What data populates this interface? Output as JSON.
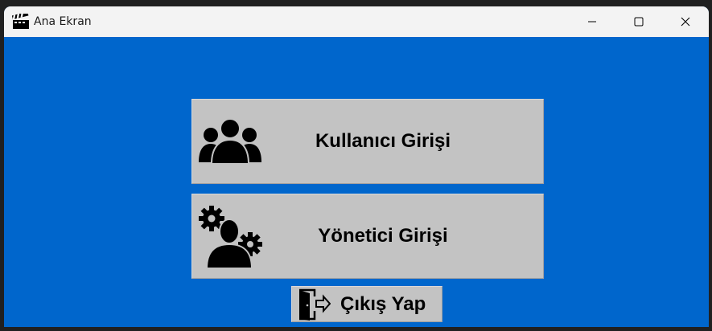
{
  "window": {
    "title": "Ana Ekran",
    "app_icon": "clapperboard-icon",
    "controls": [
      "minimize-icon",
      "maximize-icon",
      "close-icon"
    ]
  },
  "buttons": {
    "user_login": {
      "label": "Kullanıcı Girişi",
      "icon": "users-group-icon"
    },
    "admin_login": {
      "label": "Yönetici Girişi",
      "icon": "admin-gears-icon"
    },
    "exit": {
      "label": "Çıkış Yap",
      "icon": "exit-door-icon"
    }
  },
  "colors": {
    "background": "#0066cc",
    "button_face": "#c3c3c3",
    "titlebar": "#f3f3f3"
  }
}
